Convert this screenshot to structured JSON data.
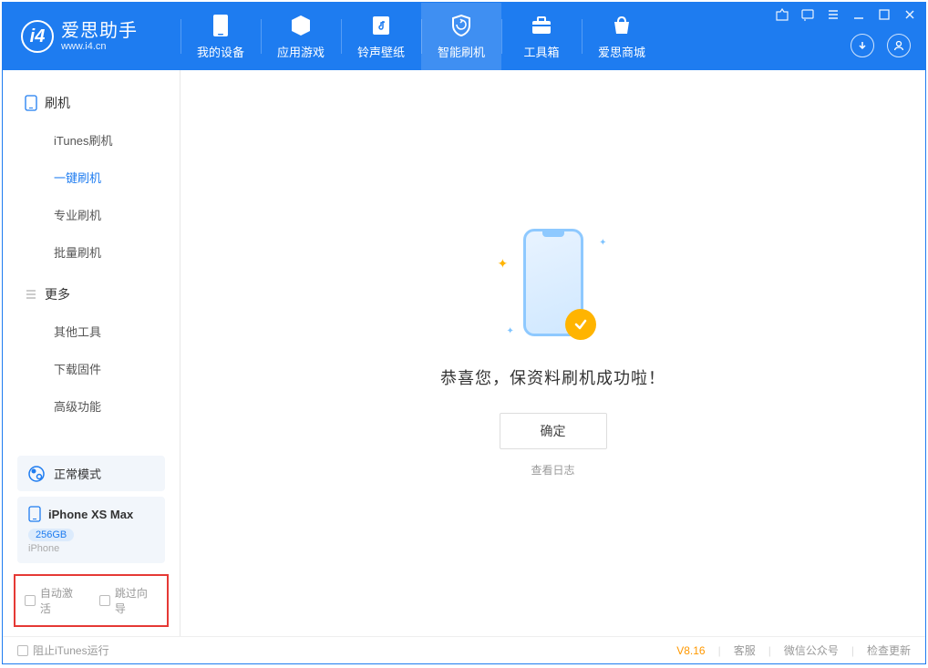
{
  "app": {
    "title": "爱思助手",
    "subtitle": "www.i4.cn"
  },
  "nav": {
    "items": [
      {
        "label": "我的设备"
      },
      {
        "label": "应用游戏"
      },
      {
        "label": "铃声壁纸"
      },
      {
        "label": "智能刷机"
      },
      {
        "label": "工具箱"
      },
      {
        "label": "爱思商城"
      }
    ]
  },
  "sidebar": {
    "section1": {
      "title": "刷机",
      "items": [
        "iTunes刷机",
        "一键刷机",
        "专业刷机",
        "批量刷机"
      ]
    },
    "section2": {
      "title": "更多",
      "items": [
        "其他工具",
        "下载固件",
        "高级功能"
      ]
    },
    "status": {
      "label": "正常模式"
    },
    "device": {
      "name": "iPhone XS Max",
      "storage": "256GB",
      "type": "iPhone"
    },
    "checks": {
      "auto_activate": "自动激活",
      "skip_guide": "跳过向导"
    }
  },
  "main": {
    "success_message": "恭喜您，保资料刷机成功啦！",
    "ok_button": "确定",
    "view_log": "查看日志"
  },
  "footer": {
    "block_itunes": "阻止iTunes运行",
    "version": "V8.16",
    "links": [
      "客服",
      "微信公众号",
      "检查更新"
    ]
  }
}
